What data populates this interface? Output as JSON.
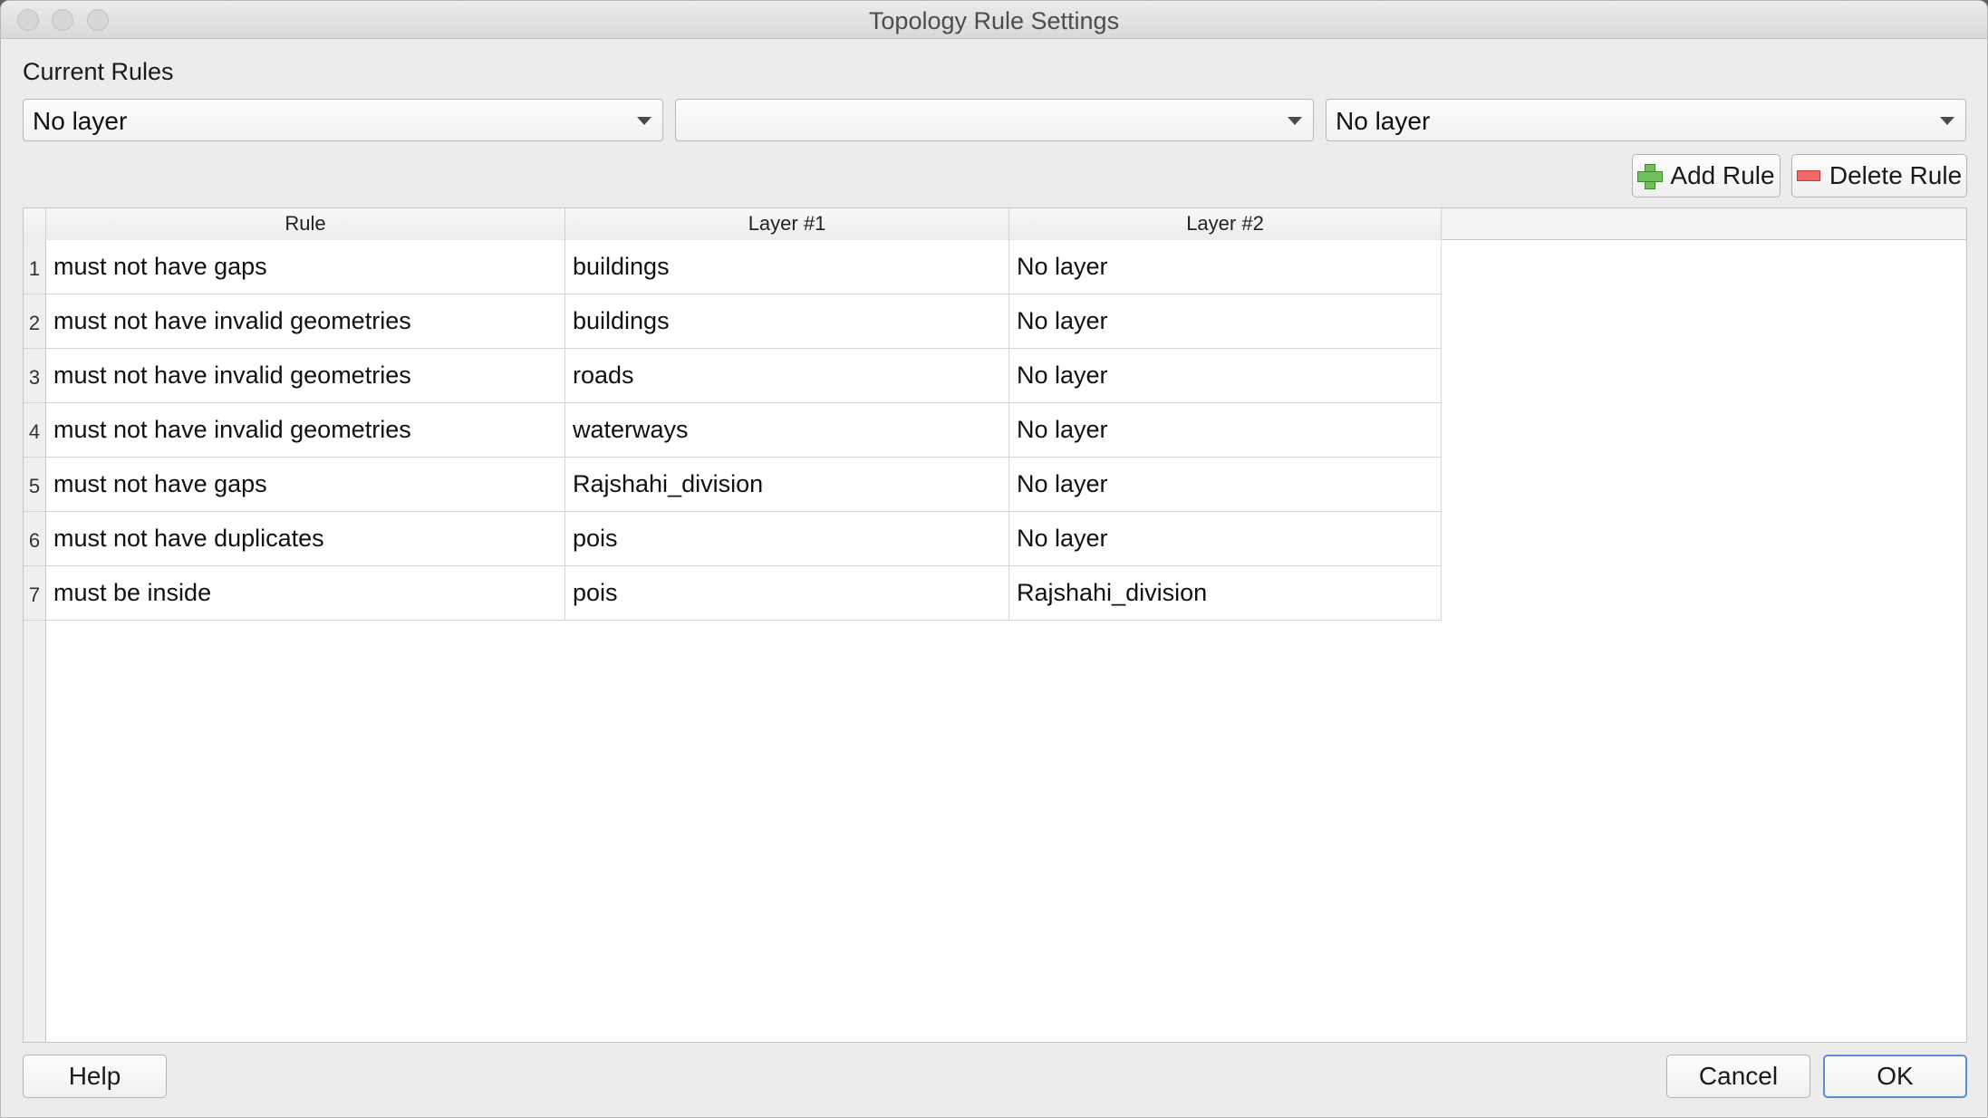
{
  "window": {
    "title": "Topology Rule Settings"
  },
  "current_rules_label": "Current Rules",
  "selectors": {
    "layer1": "No layer",
    "rule": "",
    "layer2": "No layer"
  },
  "buttons": {
    "add_rule": "Add Rule",
    "delete_rule": "Delete Rule",
    "help": "Help",
    "cancel": "Cancel",
    "ok": "OK"
  },
  "table": {
    "columns": [
      "Rule",
      "Layer #1",
      "Layer #2"
    ],
    "rows": [
      {
        "num": "1",
        "rule": "must not have gaps",
        "layer1": "buildings",
        "layer2": "No layer"
      },
      {
        "num": "2",
        "rule": "must not have invalid geometries",
        "layer1": "buildings",
        "layer2": "No layer"
      },
      {
        "num": "3",
        "rule": "must not have invalid geometries",
        "layer1": "roads",
        "layer2": "No layer"
      },
      {
        "num": "4",
        "rule": "must not have invalid geometries",
        "layer1": "waterways",
        "layer2": "No layer"
      },
      {
        "num": "5",
        "rule": "must not have gaps",
        "layer1": "Rajshahi_division",
        "layer2": "No layer"
      },
      {
        "num": "6",
        "rule": "must not have duplicates",
        "layer1": "pois",
        "layer2": "No layer"
      },
      {
        "num": "7",
        "rule": "must be inside",
        "layer1": "pois",
        "layer2": "Rajshahi_division"
      }
    ]
  },
  "icons": {
    "add_rule": "plus-icon",
    "delete_rule": "minus-icon",
    "combo_arrow": "chevron-down-icon"
  },
  "colors": {
    "add_icon": "#6fbf5a",
    "delete_icon": "#f06a6a",
    "ok_border": "#5a8fd6"
  }
}
